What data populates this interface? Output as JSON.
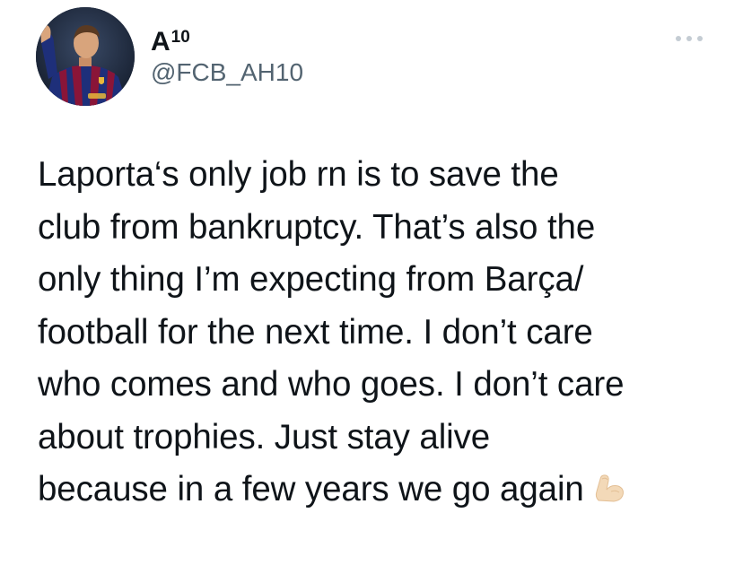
{
  "author": {
    "display_name": "A",
    "display_name_superscript": "10",
    "handle": "@FCB_AH10"
  },
  "more_icon": "ellipsis-icon",
  "tweet": {
    "lines": [
      "Laporta‘s only job rn is to save the",
      "club from bankruptcy. That’s also the",
      "only thing I’m expecting from Barça/",
      "football for the next time. I don’t care",
      "who comes and who goes. I don’t care",
      "about trophies. Just stay alive",
      "because in a few years we go again"
    ],
    "emoji": "flexed-biceps-icon"
  },
  "colors": {
    "text": "#0f1419",
    "secondary": "#536471",
    "dots": "#c4ccd3",
    "emoji_skin": "#f3d9b8"
  }
}
